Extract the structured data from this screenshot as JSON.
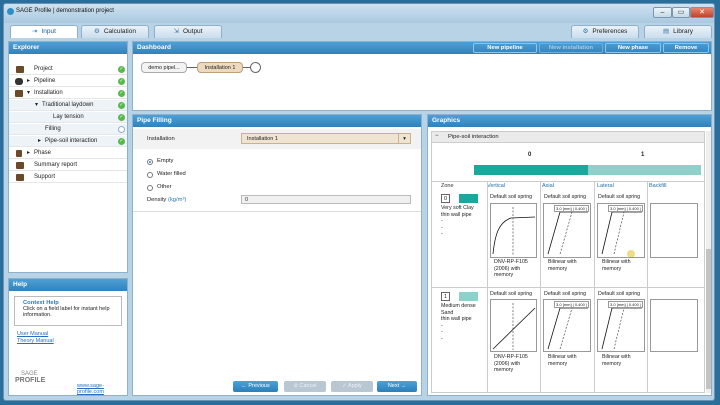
{
  "window": {
    "title": "SAGE Profile | demonstration project",
    "min": "–",
    "max": "▭",
    "close": "✕"
  },
  "tabs": {
    "input": "Input",
    "calculation": "Calculation",
    "output": "Output",
    "preferences": "Preferences",
    "library": "Library"
  },
  "explorer": {
    "title": "Explorer",
    "items": [
      {
        "label": "Project",
        "status": "ok"
      },
      {
        "label": "Pipeline",
        "status": "ok",
        "arrow": "▸"
      },
      {
        "label": "Installation",
        "status": "ok",
        "arrow": "▾"
      },
      {
        "label": "Traditional laydown",
        "status": "ok",
        "arrow": "▾"
      },
      {
        "label": "Lay tension",
        "status": "ok"
      },
      {
        "label": "Filling",
        "status": "pending"
      },
      {
        "label": "Pipe-soil interaction",
        "status": "ok",
        "arrow": "▸"
      },
      {
        "label": "Phase",
        "arrow": "▸"
      },
      {
        "label": "Summary report"
      },
      {
        "label": "Support"
      }
    ]
  },
  "help": {
    "title": "Help",
    "heading": "Context Help",
    "body": "Click on a field label for instant help information.",
    "link1": "User Manual",
    "link2": "Theory Manual",
    "logo1": "SAGE",
    "logo2": "PROFILE",
    "url": "www.sage-profile.com"
  },
  "dashboard": {
    "title": "Dashboard",
    "new_pipeline": "New pipeline",
    "new_installation": "New installation",
    "new_phase": "New phase",
    "remove": "Remove",
    "node1": "demo pipel...",
    "node2": "Installation 1"
  },
  "filling": {
    "title": "Pipe Filling",
    "installation_label": "Installation",
    "installation_value": "Installation 1",
    "options": [
      "Empty",
      "Water filled",
      "Other"
    ],
    "density_label": "Density",
    "density_unit": "(kg/m³)",
    "density_value": "0"
  },
  "buttons": {
    "previous": "Previous",
    "cancel": "Cancel",
    "apply": "Apply",
    "next": "Next"
  },
  "graphics": {
    "title": "Graphics",
    "section": "Pipe-soil interaction",
    "bar_labels": [
      "0",
      "1"
    ],
    "columns": [
      "Zone",
      "Vertical",
      "Axial",
      "Lateral",
      "Backfill"
    ],
    "zones": [
      {
        "num": "0",
        "desc": [
          "Very soft Clay",
          "thin wall pipe",
          "-",
          "-",
          "-"
        ],
        "color": "#1aa89c",
        "vertical": "Default soil spring",
        "axial": "Default soil spring",
        "lateral": "Default soil spring",
        "axial_tag": "3.0 [mm] | 0.400 |",
        "lateral_tag": "3.0 [mm] | 0.400 |",
        "v_caption": [
          "DNV-RP-F105",
          "(2006) with",
          "memory"
        ],
        "a_caption": [
          "Bilinear with",
          "memory"
        ],
        "l_caption": [
          "Bilinear with",
          "memory"
        ]
      },
      {
        "num": "1",
        "desc": [
          "Medium dense",
          "Sand",
          "thin wall pipe",
          "-",
          "-",
          "-"
        ],
        "color": "#8fd0ca",
        "vertical": "Default soil spring",
        "axial": "Default soil spring",
        "lateral": "Default soil spring",
        "axial_tag": "3.0 [mm] | 0.400 |",
        "lateral_tag": "3.0 [mm] | 0.400 |",
        "v_caption": [
          "DNV-RP-F105",
          "(2006) with",
          "memory"
        ],
        "a_caption": [
          "Bilinear with",
          "memory"
        ],
        "l_caption": [
          "Bilinear with",
          "memory"
        ]
      }
    ]
  }
}
